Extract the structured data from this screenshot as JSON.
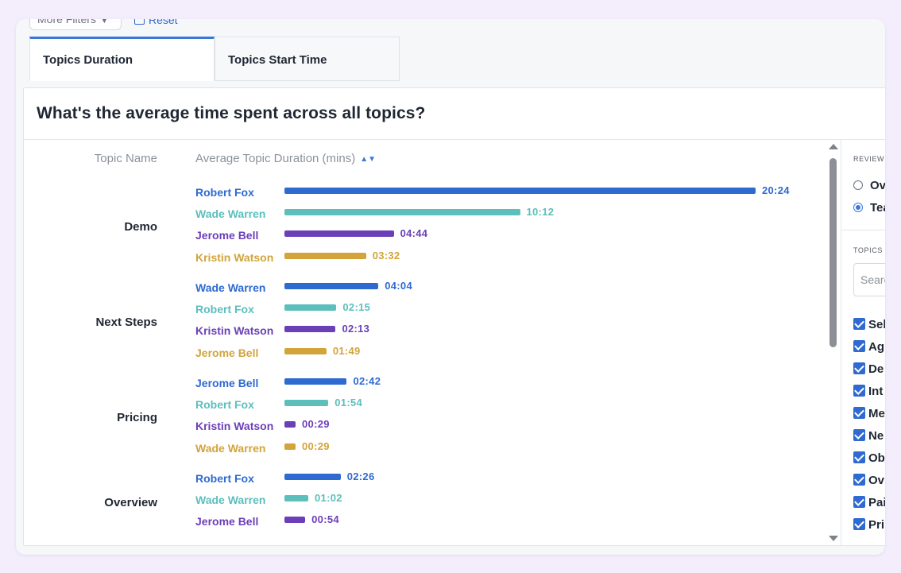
{
  "toolbar": {
    "more_filters_label": "More Filters",
    "reset_label": "Reset"
  },
  "tabs": [
    {
      "label": "Topics Duration",
      "active": true
    },
    {
      "label": "Topics Start Time",
      "active": false
    }
  ],
  "panel": {
    "title": "What's the average time spent across all topics?",
    "col_topic": "Topic Name",
    "col_duration": "Average Topic Duration (mins)"
  },
  "colors": {
    "series_1": "#2f6ad0",
    "series_2": "#5cbfbb",
    "series_3": "#6b3fb8",
    "series_4": "#d2a43a"
  },
  "chart_data": {
    "type": "bar",
    "orientation": "horizontal",
    "max_value_minutes": 20.4,
    "groups": [
      {
        "topic": "Demo",
        "rows": [
          {
            "name": "Robert Fox",
            "value": 20.4,
            "label": "20:24"
          },
          {
            "name": "Wade Warren",
            "value": 10.2,
            "label": "10:12"
          },
          {
            "name": "Jerome Bell",
            "value": 4.733,
            "label": "04:44"
          },
          {
            "name": "Kristin Watson",
            "value": 3.533,
            "label": "03:32"
          }
        ]
      },
      {
        "topic": "Next Steps",
        "rows": [
          {
            "name": "Wade Warren",
            "value": 4.067,
            "label": "04:04"
          },
          {
            "name": "Robert Fox",
            "value": 2.25,
            "label": "02:15"
          },
          {
            "name": "Kristin Watson",
            "value": 2.217,
            "label": "02:13"
          },
          {
            "name": "Jerome Bell",
            "value": 1.817,
            "label": "01:49"
          }
        ]
      },
      {
        "topic": "Pricing",
        "rows": [
          {
            "name": "Jerome Bell",
            "value": 2.7,
            "label": "02:42"
          },
          {
            "name": "Robert Fox",
            "value": 1.9,
            "label": "01:54"
          },
          {
            "name": "Kristin Watson",
            "value": 0.483,
            "label": "00:29"
          },
          {
            "name": "Wade Warren",
            "value": 0.483,
            "label": "00:29"
          }
        ]
      },
      {
        "topic": "Overview",
        "rows": [
          {
            "name": "Robert Fox",
            "value": 2.433,
            "label": "02:26"
          },
          {
            "name": "Wade Warren",
            "value": 1.033,
            "label": "01:02"
          },
          {
            "name": "Jerome Bell",
            "value": 0.9,
            "label": "00:54"
          }
        ]
      }
    ]
  },
  "side": {
    "review_heading": "REVIEW",
    "radios": [
      {
        "label": "Ov",
        "checked": false
      },
      {
        "label": "Tea",
        "checked": true
      }
    ],
    "topics_heading": "TOPICS I",
    "search_placeholder": "Search",
    "checkboxes": [
      "Sel",
      "Ag",
      "De",
      "Int",
      "Me",
      "Ne",
      "Ob",
      "Ov",
      "Pai",
      "Pri"
    ]
  }
}
